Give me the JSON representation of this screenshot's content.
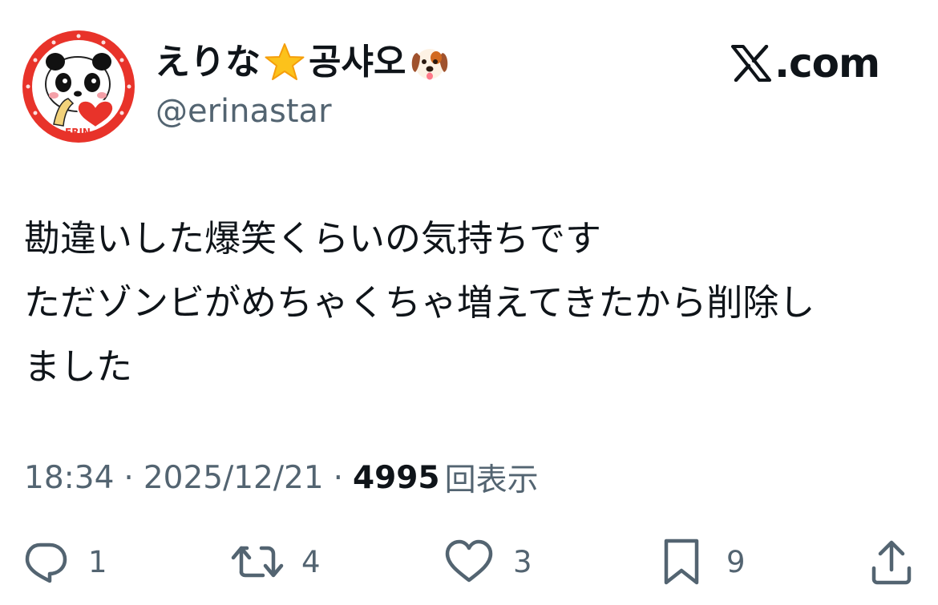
{
  "colors": {
    "text_primary": "#0f1419",
    "text_secondary": "#536471",
    "avatar_ring": "#e8332a"
  },
  "author": {
    "display_name_part1": "えりな",
    "display_name_emoji1": "star-emoji",
    "display_name_part2": "공샤오",
    "display_name_emoji2": "dog-face-emoji",
    "handle": "@erinastar",
    "avatar": "panda-avatar",
    "avatar_text": "ERIN"
  },
  "brand": {
    "logo": "x-logo-icon",
    "text": ".com"
  },
  "post": {
    "lines": [
      "勘違いした爆笑くらいの気持ちです",
      "ただゾンビがめちゃくちゃ増えてきたから削除し",
      "ました"
    ]
  },
  "meta": {
    "time": "18:34",
    "separator": "·",
    "date": "2025/12/21",
    "views_count": "4995",
    "views_label": "回表示"
  },
  "actions": {
    "reply": {
      "icon": "reply-icon",
      "count": "1"
    },
    "repost": {
      "icon": "repost-icon",
      "count": "4"
    },
    "like": {
      "icon": "heart-icon",
      "count": "3"
    },
    "bookmark": {
      "icon": "bookmark-icon",
      "count": "9"
    },
    "share": {
      "icon": "share-icon"
    }
  }
}
